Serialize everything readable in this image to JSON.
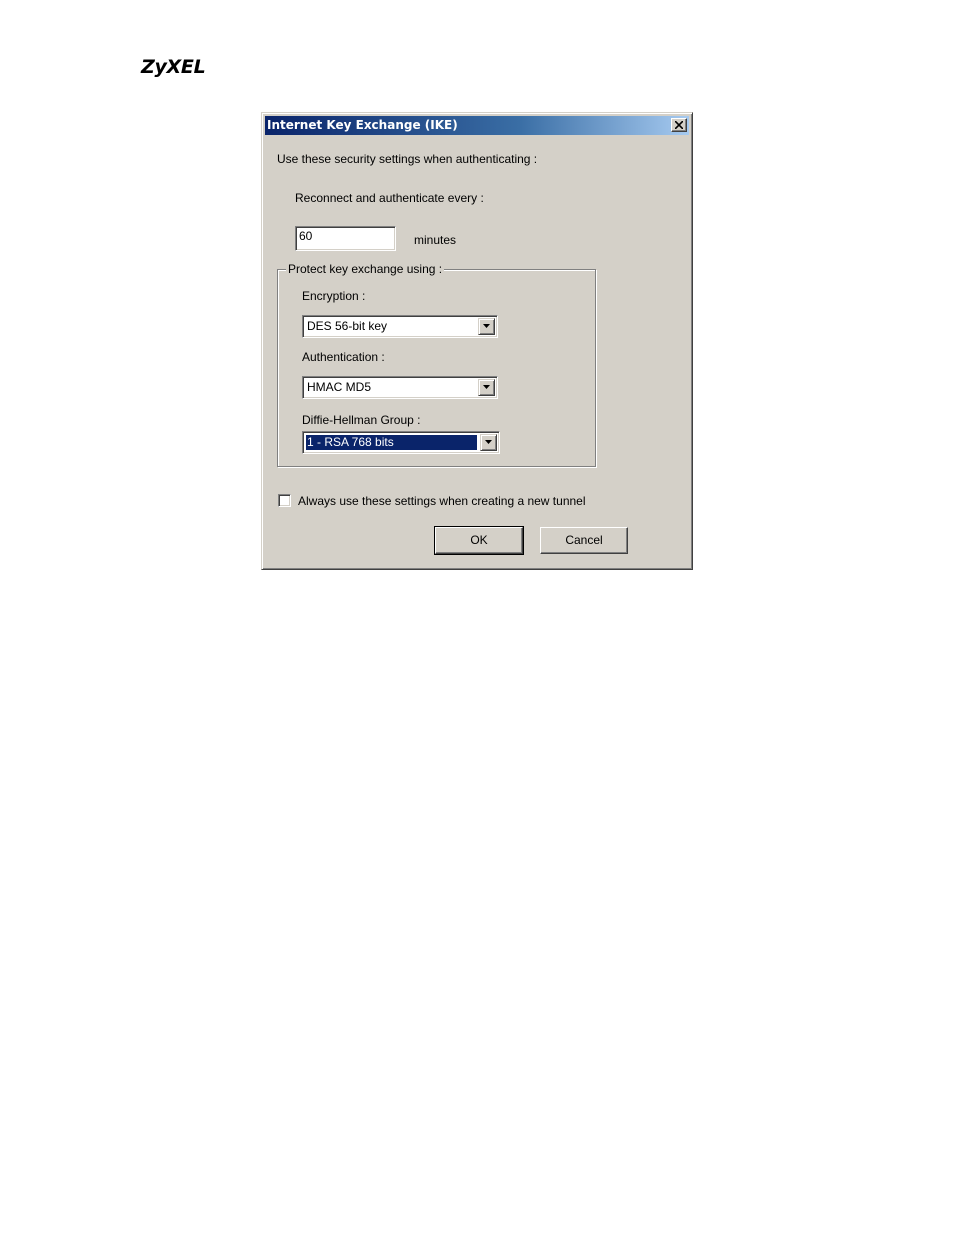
{
  "header": {
    "logo_text": "ZyXEL"
  },
  "dialog": {
    "title": "Internet Key Exchange (IKE)",
    "close_icon": "close-x-icon",
    "intro_label": "Use these security settings when authenticating :",
    "reconnect_label": "Reconnect and authenticate every :",
    "reconnect_value": "60",
    "reconnect_unit": "minutes",
    "group_label": "Protect key exchange using :",
    "encryption": {
      "label": "Encryption :",
      "selected": "DES 56-bit key"
    },
    "authentication": {
      "label": "Authentication :",
      "selected": "HMAC MD5"
    },
    "dh_group": {
      "label": "Diffie-Hellman Group :",
      "selected": "1 - RSA 768 bits"
    },
    "always_use_checkbox": {
      "label": "Always use these settings when creating a new tunnel",
      "checked": false
    },
    "ok_label": "OK",
    "cancel_label": "Cancel"
  },
  "colors": {
    "dialog_face": "#d4d0c8",
    "title_gradient_start": "#0a246a",
    "title_gradient_end": "#a6caf0",
    "selection_highlight": "#0a246a"
  }
}
